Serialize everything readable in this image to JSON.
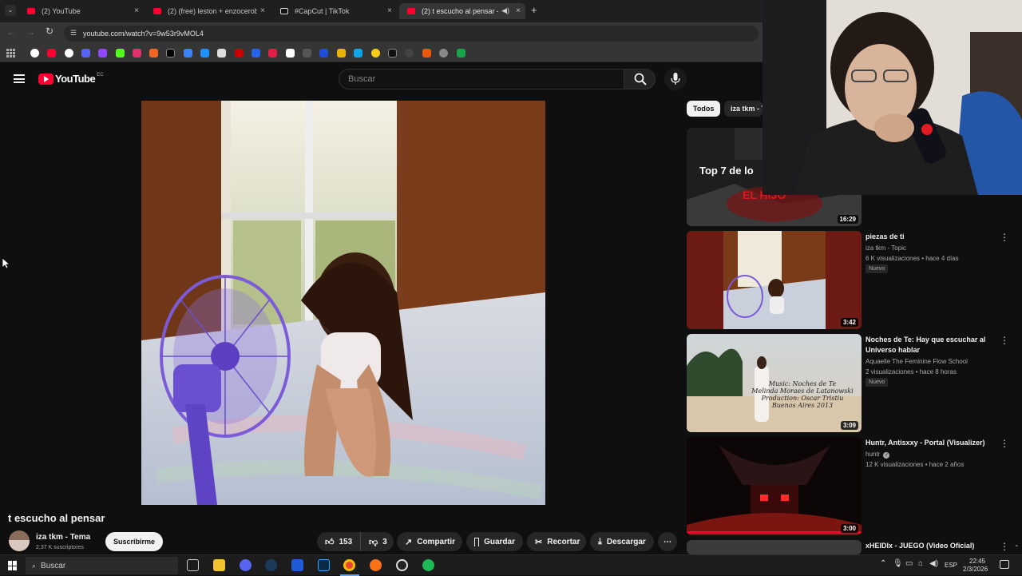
{
  "browser": {
    "tabs": [
      {
        "label": "(2) YouTube",
        "close": "×"
      },
      {
        "label": "(2) (free) leston + enzocerobull...",
        "close": "×"
      },
      {
        "label": "#CapCut | TikTok",
        "close": "×"
      },
      {
        "label": "(2) t escucho al pensar - Yo",
        "close": "×"
      }
    ],
    "new_tab": "+",
    "url": "youtube.com/watch?v=9w53r9vMOL4"
  },
  "header": {
    "logo_text": "YouTube",
    "region": "EC",
    "search_placeholder": "Buscar"
  },
  "video": {
    "title": "t escucho al pensar",
    "channel": "iza tkm - Tema",
    "subscribers": "2,37 K suscriptores",
    "subscribe_label": "Suscribirme",
    "likes": "153",
    "dislikes": "3",
    "share_label": "Compartir",
    "save_label": "Guardar",
    "clip_label": "Recortar",
    "download_label": "Descargar",
    "more_label": "⋯"
  },
  "sidebar": {
    "chips": [
      "Todos",
      "iza tkm - T"
    ],
    "items": [
      {
        "thumb_text": "Top 7 de lo",
        "thumb_sub": "EL HIJO",
        "duration": "16:29"
      },
      {
        "title": "piezas de ti",
        "channel": "iza tkm - Topic",
        "meta": "6 K visualizaciones • hace 4 días",
        "badge": "Nuevo",
        "duration": "3:42"
      },
      {
        "title": "Noches de Te: Hay que escuchar al Universo hablar",
        "channel": "Aquaelle The Feminine Flow School",
        "meta": "2 visualizaciones • hace 8 horas",
        "badge": "Nuevo",
        "duration": "3:09",
        "overlay": [
          "Music: Noches de Te",
          "Melinda Moraes de Latanowski",
          "Production: Oscar Tristiu",
          "Buenos Aires 2013"
        ]
      },
      {
        "title": "Huntr, Antisxxy - Portal (Visualizer)",
        "channel": "huntr",
        "meta": "12 K visualizaciones • hace 2 años",
        "duration": "3:00"
      },
      {
        "title": "xHEIDIx - JUEGO (Video Oficial)"
      }
    ]
  },
  "taskbar": {
    "search_placeholder": "Buscar",
    "lang": "ESP",
    "time": "22:45",
    "date": "2/3/2026"
  }
}
